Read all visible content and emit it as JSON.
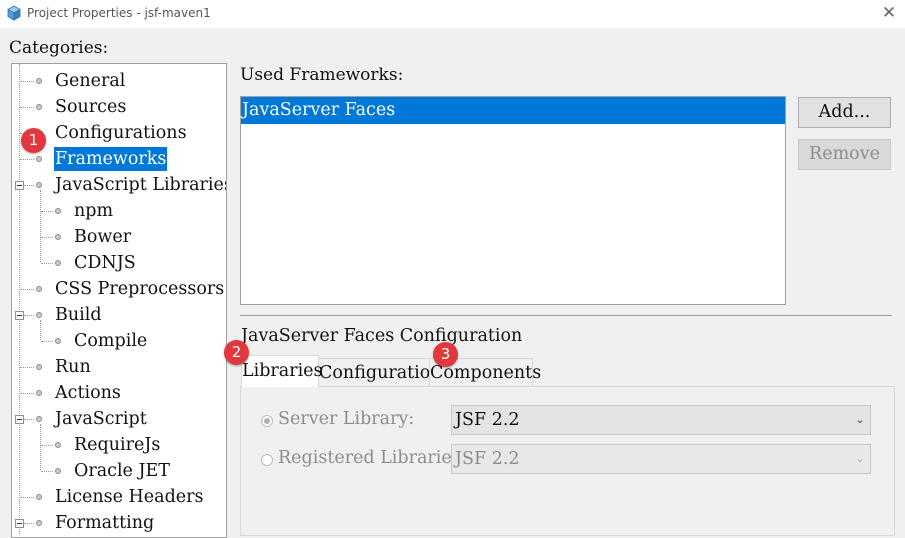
{
  "window": {
    "title": "Project Properties - jsf-maven1",
    "close_glyph": "✕"
  },
  "categories": {
    "label": "Categories:",
    "items": [
      {
        "label": "General"
      },
      {
        "label": "Sources"
      },
      {
        "label": "Configurations"
      },
      {
        "label": "Frameworks",
        "selected": true
      },
      {
        "label": "JavaScript Libraries",
        "expandable": true
      },
      {
        "label": "npm"
      },
      {
        "label": "Bower"
      },
      {
        "label": "CDNJS"
      },
      {
        "label": "CSS Preprocessors"
      },
      {
        "label": "Build",
        "expandable": true
      },
      {
        "label": "Compile"
      },
      {
        "label": "Run"
      },
      {
        "label": "Actions"
      },
      {
        "label": "JavaScript",
        "expandable": true
      },
      {
        "label": "RequireJs"
      },
      {
        "label": "Oracle JET"
      },
      {
        "label": "License Headers"
      },
      {
        "label": "Formatting",
        "expandable": true
      }
    ]
  },
  "frameworks": {
    "label": "Used Frameworks:",
    "items": [
      "JavaServer Faces"
    ],
    "add_button": "Add...",
    "remove_button": "Remove"
  },
  "config": {
    "title": "JavaServer Faces Configuration",
    "tabs": [
      "Libraries",
      "Configuration",
      "Components"
    ],
    "active_tab": "Libraries",
    "server_library": {
      "label": "Server Library:",
      "value": "JSF 2.2",
      "checked": true
    },
    "registered_libraries": {
      "label": "Registered Libraries:",
      "value": "JSF 2.2",
      "checked": false
    }
  },
  "callouts": [
    "1",
    "2",
    "3"
  ],
  "colors": {
    "selection": "#0078d7",
    "callout": "#e0383e"
  }
}
